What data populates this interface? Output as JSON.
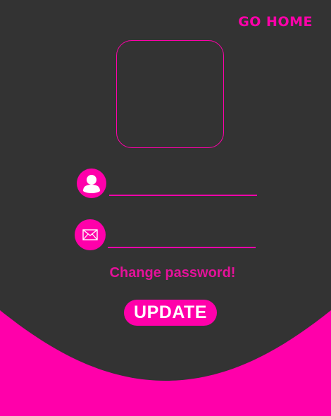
{
  "colors": {
    "background": "#ff00aa",
    "panel": "#333333",
    "accent": "#ff00aa",
    "link_text": "#e5119a",
    "button_text": "#ffffff"
  },
  "header": {
    "go_home_label": "GO HOME"
  },
  "profile": {
    "avatar_placeholder": ""
  },
  "form": {
    "username": {
      "icon": "user-icon",
      "value": "",
      "placeholder": ""
    },
    "email": {
      "icon": "mail-icon",
      "value": "",
      "placeholder": ""
    },
    "change_password_label": "Change password!",
    "update_label": "UPDATE"
  }
}
